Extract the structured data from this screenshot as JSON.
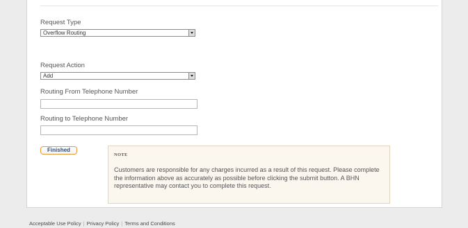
{
  "form": {
    "request_type": {
      "label": "Request Type",
      "value": "Overflow Routing"
    },
    "request_action": {
      "label": "Request Action",
      "value": "Add"
    },
    "routing_from": {
      "label": "Routing From Telephone Number",
      "value": ""
    },
    "routing_to": {
      "label": "Routing to Telephone Number",
      "value": ""
    },
    "finished_label": "Finished"
  },
  "note": {
    "title": "NOTE",
    "text": "Customers are responsible for any charges incurred as a result of this request. Please complete the information above as accurately as possible before clicking the submit button. A BHN representative may contact you to complete this request."
  },
  "footer": {
    "links": [
      "Acceptable Use Policy",
      "Privacy Policy",
      "Terms and Conditions"
    ],
    "separator": "|"
  }
}
